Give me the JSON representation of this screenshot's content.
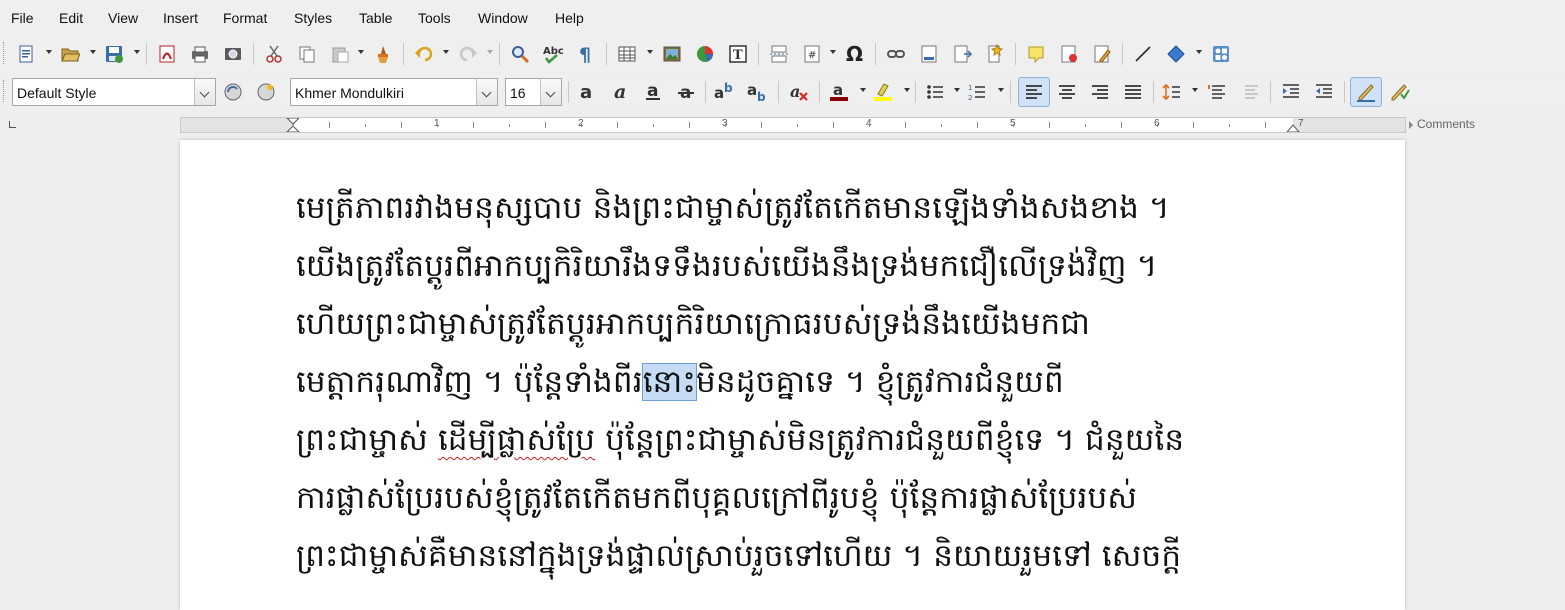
{
  "menu": [
    "File",
    "Edit",
    "View",
    "Insert",
    "Format",
    "Styles",
    "Table",
    "Tools",
    "Window",
    "Help"
  ],
  "formatting": {
    "paragraph_style": "Default Style",
    "font_name": "Khmer Mondulkiri",
    "font_size": "16"
  },
  "ruler": {
    "numbers": [
      "1",
      "2",
      "3",
      "4",
      "5",
      "6",
      "7"
    ],
    "comments_label": "Comments"
  },
  "toolbar1_icons": [
    "new-document-icon",
    "open-folder-icon",
    "save-icon",
    "export-pdf-icon",
    "print-icon",
    "print-preview-icon",
    "cut-icon",
    "copy-icon",
    "paste-icon",
    "clone-formatting-icon",
    "undo-icon",
    "redo-icon",
    "find-replace-icon",
    "spellcheck-icon",
    "formatting-marks-icon",
    "insert-table-icon",
    "insert-image-icon",
    "insert-chart-icon",
    "insert-textbox-icon",
    "page-break-icon",
    "insert-field-icon",
    "special-character-icon",
    "hyperlink-icon",
    "footnote-icon",
    "endnote-icon",
    "bookmark-icon",
    "comment-icon",
    "track-changes-icon",
    "show-track-changes-icon",
    "line-icon",
    "basic-shapes-icon",
    "draw-functions-icon"
  ],
  "toolbar2_icons": [
    "update-style-icon",
    "new-style-icon",
    "bold-icon",
    "italic-icon",
    "underline-icon",
    "strikethrough-icon",
    "superscript-icon",
    "subscript-icon",
    "clear-formatting-icon",
    "font-color-icon",
    "highlight-color-icon",
    "bullets-icon",
    "numbering-icon",
    "align-left-icon",
    "align-center-icon",
    "align-right-icon",
    "justify-icon",
    "line-spacing-icon",
    "increase-paragraph-spacing-icon",
    "decrease-paragraph-spacing-icon",
    "increase-indent-icon",
    "decrease-indent-icon",
    "text-direction-ltr-icon",
    "text-direction-rtl-icon"
  ],
  "colors": {
    "font_color_bar": "#8b0000",
    "highlight_bar": "#ffff00",
    "selection": "#c6dcf5"
  },
  "document": {
    "line1": "មេត្រីភាពរវាងមនុស្សបាប  និងព្រះជាម្ចាស់ត្រូវតែកើតមានឡើងទាំងសងខាង ។",
    "line2": "យើងត្រូវតែប្តូរពីអាកប្បកិរិយារឹងទទឹងរបស់យើងនឹងទ្រង់មកជឿលើទ្រង់វិញ ។",
    "line3": "ហើយព្រះជាម្ចាស់ត្រូវតែប្តូរអាកប្បកិរិយាក្រោធរបស់ទ្រង់នឹងយើងមកជា",
    "line4_a": "មេត្តាករុណាវិញ ។  ប៉ុន្តែទាំងពីរ",
    "line4_sel": "នោះ",
    "line4_b": "មិនដូចគ្នាទេ ។  ខ្ញុំត្រូវការជំនួយពី",
    "line5_a": "ព្រះជាម្ចាស់  ",
    "line5_err": "ដើម្បីផ្លាស់ប្រែ",
    "line5_b": "  ប៉ុន្តែព្រះជាម្ចាស់មិនត្រូវការជំនួយពីខ្ញុំទេ ។  ជំនួយនៃ",
    "line6": "ការផ្លាស់ប្រែរបស់ខ្ញុំត្រូវតែកើតមកពីបុគ្គលក្រៅពីរូបខ្ញុំ  ប៉ុន្តែការផ្លាស់ប្រែរបស់",
    "line7": "ព្រះជាម្ចាស់គឺមាននៅក្នុងទ្រង់ផ្ទាល់ស្រាប់រួចទៅហើយ ។  និយាយរួមទៅ  សេចក្តី"
  }
}
